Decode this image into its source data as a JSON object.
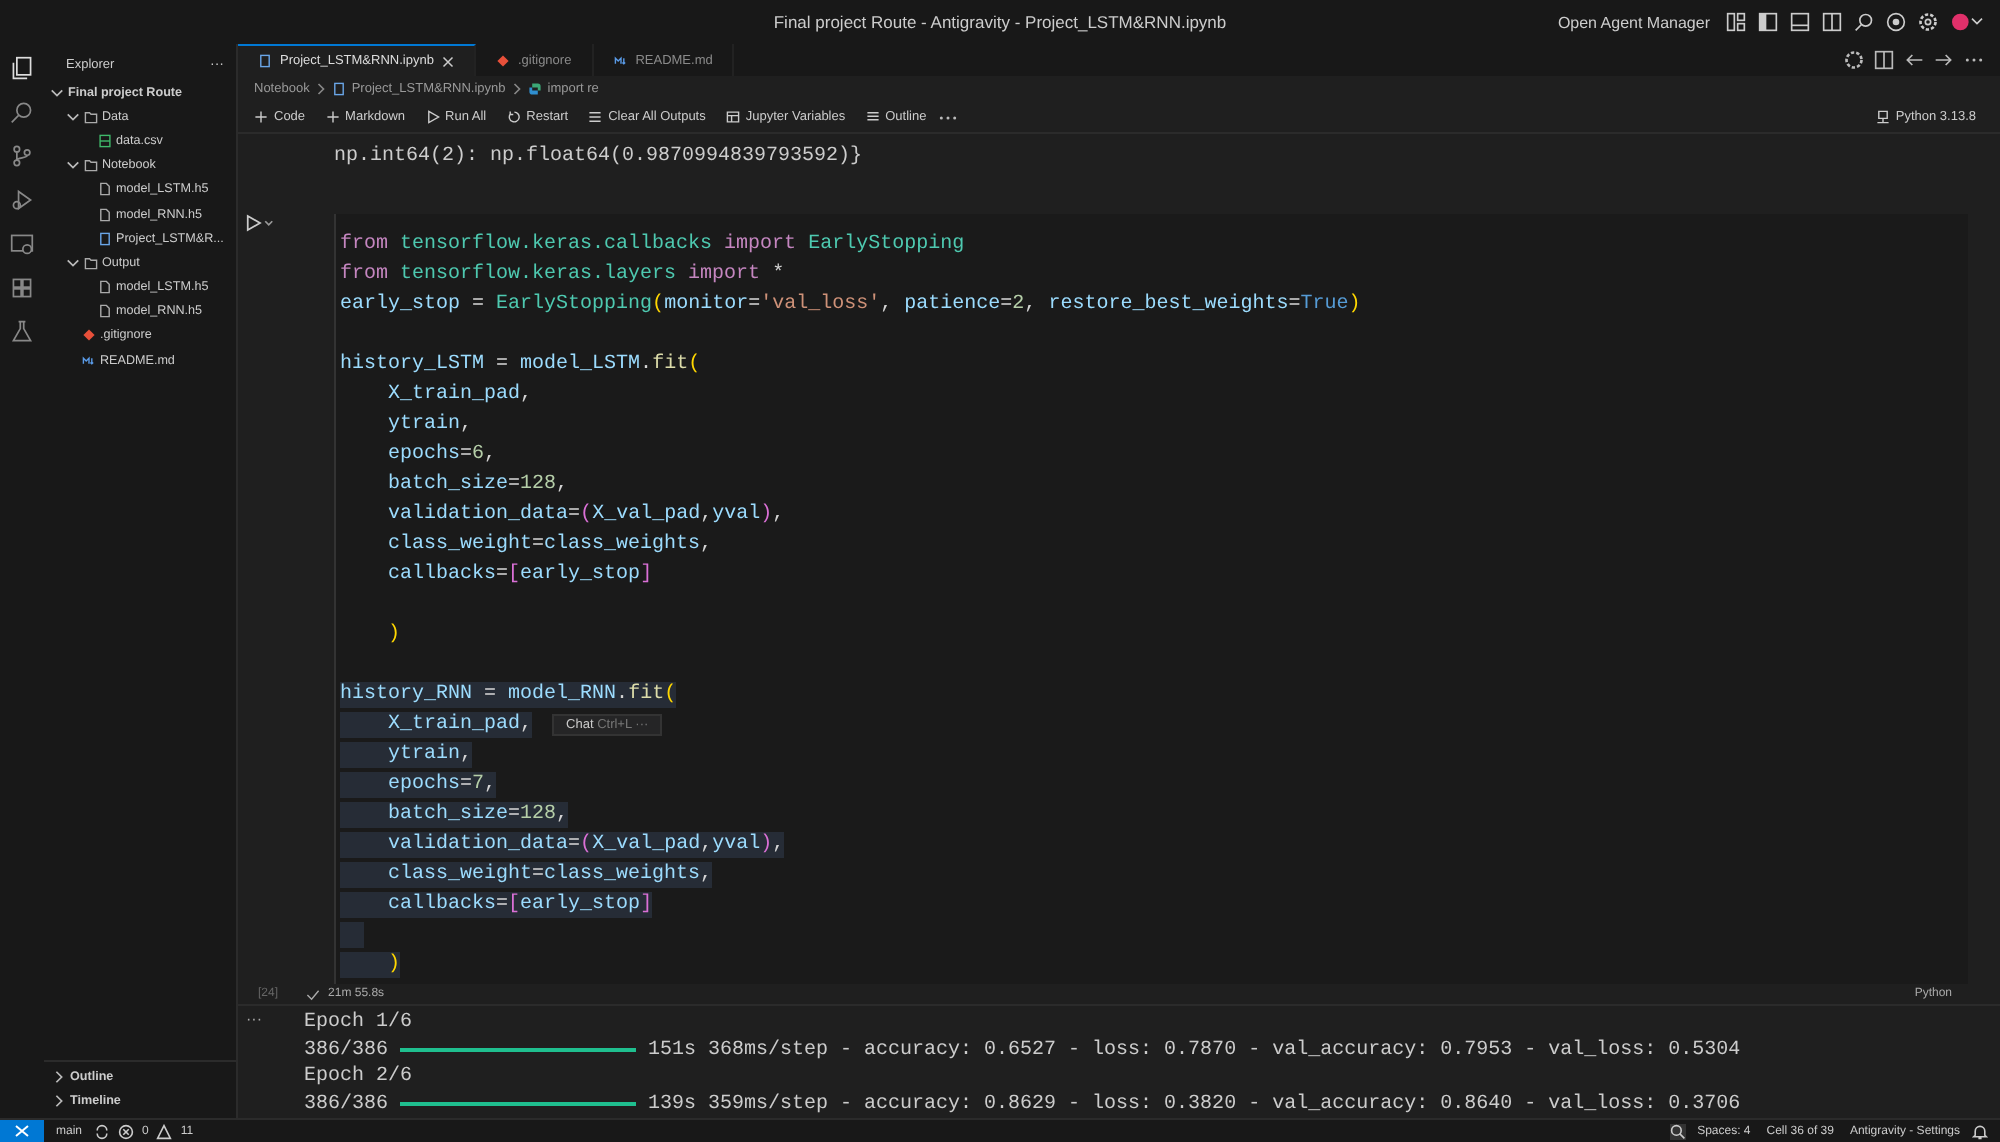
{
  "window": {
    "title": "Final project Route - Antigravity - Project_LSTM&RNN.ipynb",
    "agent_manager": "Open Agent Manager"
  },
  "sidebar": {
    "title": "Explorer",
    "more": "···",
    "tree": [
      {
        "label": "Final project Route",
        "kind": "root",
        "expanded": true,
        "children": [
          {
            "label": "Data",
            "kind": "folder",
            "expanded": true,
            "children": [
              {
                "label": "data.csv",
                "kind": "csv"
              }
            ]
          },
          {
            "label": "Notebook",
            "kind": "folder",
            "expanded": true,
            "children": [
              {
                "label": "model_LSTM.h5",
                "kind": "file"
              },
              {
                "label": "model_RNN.h5",
                "kind": "file"
              },
              {
                "label": "Project_LSTM&R...",
                "kind": "notebook"
              }
            ]
          },
          {
            "label": "Output",
            "kind": "folder",
            "expanded": true,
            "children": [
              {
                "label": "model_LSTM.h5",
                "kind": "file"
              },
              {
                "label": "model_RNN.h5",
                "kind": "file"
              }
            ]
          },
          {
            "label": ".gitignore",
            "kind": "git"
          },
          {
            "label": "README.md",
            "kind": "md"
          }
        ]
      }
    ],
    "sections": [
      {
        "label": "Outline",
        "expanded": false
      },
      {
        "label": "Timeline",
        "expanded": false
      }
    ]
  },
  "tabs": [
    {
      "label": "Project_LSTM&RNN.ipynb",
      "kind": "notebook",
      "selected": true
    },
    {
      "label": ".gitignore",
      "kind": "git",
      "selected": false
    },
    {
      "label": "README.md",
      "kind": "md",
      "selected": false
    }
  ],
  "breadcrumb": [
    {
      "label": "Notebook",
      "kind": "folder"
    },
    {
      "label": "Project_LSTM&RNN.ipynb",
      "kind": "notebook"
    },
    {
      "label": "import re",
      "kind": "python"
    }
  ],
  "toolbar": [
    {
      "label": "Code",
      "kind": "plus"
    },
    {
      "label": "Markdown",
      "kind": "plus"
    },
    {
      "label": "Run All",
      "kind": "run"
    },
    {
      "label": "Restart",
      "kind": "restart"
    },
    {
      "label": "Clear All Outputs",
      "kind": "clear"
    },
    {
      "label": "Jupyter Variables",
      "kind": "vars"
    },
    {
      "label": "Outline",
      "kind": "list"
    }
  ],
  "kernel": "Python 3.13.8",
  "previous_output": "np.int64(2): np.float64(0.9870994839793592)}",
  "cell": {
    "execution_count": "[24]",
    "duration": "21m 55.8s",
    "language": "Python",
    "lines": [
      {
        "highlighted": false,
        "tokens": [
          {
            "t": "from ",
            "kind": "kw"
          },
          {
            "t": "tensorflow.keras.callbacks ",
            "kind": "cls"
          },
          {
            "t": "import ",
            "kind": "kw"
          },
          {
            "t": "EarlyStopping",
            "kind": "cls"
          }
        ]
      },
      {
        "highlighted": false,
        "tokens": [
          {
            "t": "from ",
            "kind": "kw"
          },
          {
            "t": "tensorflow.keras.layers ",
            "kind": "cls"
          },
          {
            "t": "import ",
            "kind": "kw"
          },
          {
            "t": "*",
            "kind": "op"
          }
        ]
      },
      {
        "highlighted": false,
        "tokens": [
          {
            "t": "early_stop",
            "kind": "var"
          },
          {
            "t": " = ",
            "kind": "op"
          },
          {
            "t": "EarlyStopping",
            "kind": "cls"
          },
          {
            "t": "(",
            "kind": "b1"
          },
          {
            "t": "monitor",
            "kind": "var"
          },
          {
            "t": "=",
            "kind": "op"
          },
          {
            "t": "'val_loss'",
            "kind": "str"
          },
          {
            "t": ", ",
            "kind": "op"
          },
          {
            "t": "patience",
            "kind": "var"
          },
          {
            "t": "=",
            "kind": "op"
          },
          {
            "t": "2",
            "kind": "num"
          },
          {
            "t": ", ",
            "kind": "op"
          },
          {
            "t": "restore_best_weights",
            "kind": "var"
          },
          {
            "t": "=",
            "kind": "op"
          },
          {
            "t": "True",
            "kind": "const"
          },
          {
            "t": ")",
            "kind": "b1"
          }
        ]
      },
      {
        "highlighted": false
      },
      {
        "highlighted": false,
        "tokens": [
          {
            "t": "history_LSTM",
            "kind": "var"
          },
          {
            "t": " = ",
            "kind": "op"
          },
          {
            "t": "model_LSTM",
            "kind": "var"
          },
          {
            "t": ".",
            "kind": "op"
          },
          {
            "t": "fit",
            "kind": "fn"
          },
          {
            "t": "(",
            "kind": "b1"
          }
        ]
      },
      {
        "highlighted": false,
        "tokens": [
          {
            "t": "    X_train_pad",
            "kind": "var"
          },
          {
            "t": ",",
            "kind": "op"
          }
        ]
      },
      {
        "highlighted": false,
        "tokens": [
          {
            "t": "    ytrain",
            "kind": "var"
          },
          {
            "t": ",",
            "kind": "op"
          }
        ]
      },
      {
        "highlighted": false,
        "tokens": [
          {
            "t": "    epochs",
            "kind": "var"
          },
          {
            "t": "=",
            "kind": "op"
          },
          {
            "t": "6",
            "kind": "num"
          },
          {
            "t": ",",
            "kind": "op"
          }
        ]
      },
      {
        "highlighted": false,
        "tokens": [
          {
            "t": "    batch_size",
            "kind": "var"
          },
          {
            "t": "=",
            "kind": "op"
          },
          {
            "t": "128",
            "kind": "num"
          },
          {
            "t": ",",
            "kind": "op"
          }
        ]
      },
      {
        "highlighted": false,
        "tokens": [
          {
            "t": "    validation_data",
            "kind": "var"
          },
          {
            "t": "=",
            "kind": "op"
          },
          {
            "t": "(",
            "kind": "b2"
          },
          {
            "t": "X_val_pad",
            "kind": "var"
          },
          {
            "t": ",",
            "kind": "op"
          },
          {
            "t": "yval",
            "kind": "var"
          },
          {
            "t": ")",
            "kind": "b2"
          },
          {
            "t": ",",
            "kind": "op"
          }
        ]
      },
      {
        "highlighted": false,
        "tokens": [
          {
            "t": "    class_weight",
            "kind": "var"
          },
          {
            "t": "=",
            "kind": "op"
          },
          {
            "t": "class_weights",
            "kind": "var"
          },
          {
            "t": ",",
            "kind": "op"
          }
        ]
      },
      {
        "highlighted": false,
        "tokens": [
          {
            "t": "    callbacks",
            "kind": "var"
          },
          {
            "t": "=",
            "kind": "op"
          },
          {
            "t": "[",
            "kind": "b2"
          },
          {
            "t": "early_stop",
            "kind": "var"
          },
          {
            "t": "]",
            "kind": "b2"
          }
        ]
      },
      {
        "highlighted": false
      },
      {
        "highlighted": false,
        "tokens": [
          {
            "t": "    )",
            "kind": "b1"
          }
        ]
      },
      {
        "highlighted": false
      },
      {
        "highlighted": true,
        "tokens": [
          {
            "t": "history_RNN",
            "kind": "var"
          },
          {
            "t": " = ",
            "kind": "op"
          },
          {
            "t": "model_RNN",
            "kind": "var"
          },
          {
            "t": ".",
            "kind": "op"
          },
          {
            "t": "fit",
            "kind": "fn"
          },
          {
            "t": "(",
            "kind": "b1"
          }
        ]
      },
      {
        "highlighted": true,
        "tokens": [
          {
            "t": "    X_train_pad",
            "kind": "var"
          },
          {
            "t": ",",
            "kind": "op"
          }
        ],
        "hint": {
          "label": "Chat",
          "shortcut": "Ctrl+L",
          "more": "···"
        }
      },
      {
        "highlighted": true,
        "tokens": [
          {
            "t": "    ytrain",
            "kind": "var"
          },
          {
            "t": ",",
            "kind": "op"
          }
        ]
      },
      {
        "highlighted": true,
        "tokens": [
          {
            "t": "    epochs",
            "kind": "var"
          },
          {
            "t": "=",
            "kind": "op"
          },
          {
            "t": "7",
            "kind": "num"
          },
          {
            "t": ",",
            "kind": "op"
          }
        ]
      },
      {
        "highlighted": true,
        "tokens": [
          {
            "t": "    batch_size",
            "kind": "var"
          },
          {
            "t": "=",
            "kind": "op"
          },
          {
            "t": "128",
            "kind": "num"
          },
          {
            "t": ",",
            "kind": "op"
          }
        ]
      },
      {
        "highlighted": true,
        "tokens": [
          {
            "t": "    validation_data",
            "kind": "var"
          },
          {
            "t": "=",
            "kind": "op"
          },
          {
            "t": "(",
            "kind": "b2"
          },
          {
            "t": "X_val_pad",
            "kind": "var"
          },
          {
            "t": ",",
            "kind": "op"
          },
          {
            "t": "yval",
            "kind": "var"
          },
          {
            "t": ")",
            "kind": "b2"
          },
          {
            "t": ",",
            "kind": "op"
          }
        ]
      },
      {
        "highlighted": true,
        "tokens": [
          {
            "t": "    class_weight",
            "kind": "var"
          },
          {
            "t": "=",
            "kind": "op"
          },
          {
            "t": "class_weights",
            "kind": "var"
          },
          {
            "t": ",",
            "kind": "op"
          }
        ]
      },
      {
        "highlighted": true,
        "tokens": [
          {
            "t": "    callbacks",
            "kind": "var"
          },
          {
            "t": "=",
            "kind": "op"
          },
          {
            "t": "[",
            "kind": "b2"
          },
          {
            "t": "early_stop",
            "kind": "var"
          },
          {
            "t": "]",
            "kind": "b2"
          }
        ]
      },
      {
        "highlighted": true
      },
      {
        "highlighted": true,
        "tokens": [
          {
            "t": "    )",
            "kind": "b1"
          }
        ]
      }
    ]
  },
  "output": {
    "marker": "···",
    "lines": [
      {
        "kind": "text",
        "text": "Epoch 1/6"
      },
      {
        "kind": "progress",
        "steps": "386/386",
        "level": 1,
        "stats": "151s 368ms/step - accuracy: 0.6527 - loss: 0.7870 - val_accuracy: 0.7953 - val_loss: 0.5304"
      },
      {
        "kind": "text",
        "text": "Epoch 2/6"
      },
      {
        "kind": "progress",
        "steps": "386/386",
        "level": 1,
        "stats": "139s 359ms/step - accuracy: 0.8629 - loss: 0.3820 - val_accuracy: 0.8640 - val_loss: 0.3706"
      }
    ]
  },
  "status_bar": {
    "branch": "main",
    "errors": "0",
    "warnings": "11",
    "spaces": "Spaces: 4",
    "cell": "Cell 36 of 39",
    "settings": "Antigravity - Settings"
  }
}
